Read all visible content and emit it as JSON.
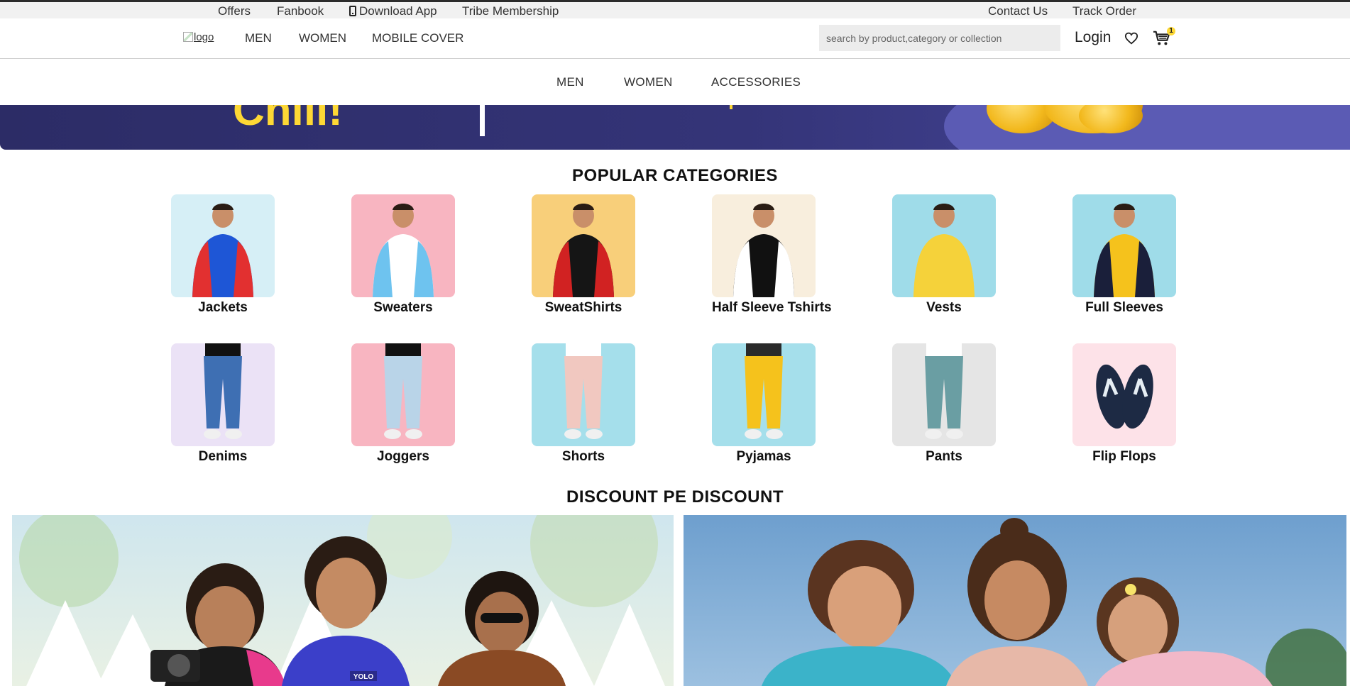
{
  "topbar": {
    "left_links": [
      "Offers",
      "Fanbook",
      "Download App",
      "Tribe Membership"
    ],
    "right_links": [
      "Contact Us",
      "Track Order"
    ]
  },
  "header": {
    "logo_alt": "logo",
    "nav": [
      "MEN",
      "WOMEN",
      "MOBILE COVER"
    ],
    "search_placeholder": "search by product,category or collection",
    "login_label": "Login",
    "cart_count": "1"
  },
  "subnav": [
    "MEN",
    "WOMEN",
    "ACCESSORIES"
  ],
  "hero": {
    "text": "Chill!"
  },
  "popular": {
    "title": "POPULAR CATEGORIES",
    "categories": [
      {
        "name": "Jackets",
        "bg": "#d6eff6"
      },
      {
        "name": "Sweaters",
        "bg": "#f8b5c1"
      },
      {
        "name": "SweatShirts",
        "bg": "#f8cf7a"
      },
      {
        "name": "Half Sleeve Tshirts",
        "bg": "#f8eedd"
      },
      {
        "name": "Vests",
        "bg": "#9fdce9"
      },
      {
        "name": "Full Sleeves",
        "bg": "#9fdce9"
      },
      {
        "name": "Denims",
        "bg": "#ebe2f6"
      },
      {
        "name": "Joggers",
        "bg": "#f8b5c1"
      },
      {
        "name": "Shorts",
        "bg": "#a5dfeb"
      },
      {
        "name": "Pyjamas",
        "bg": "#a5dfeb"
      },
      {
        "name": "Pants",
        "bg": "#e5e5e5"
      },
      {
        "name": "Flip Flops",
        "bg": "#fde2e8"
      }
    ]
  },
  "discount": {
    "title": "DISCOUNT PE DISCOUNT",
    "shirt_text": "YOLO"
  },
  "colors": {
    "accent_yellow": "#fdd835",
    "hero_navy": "#2c2c66"
  }
}
